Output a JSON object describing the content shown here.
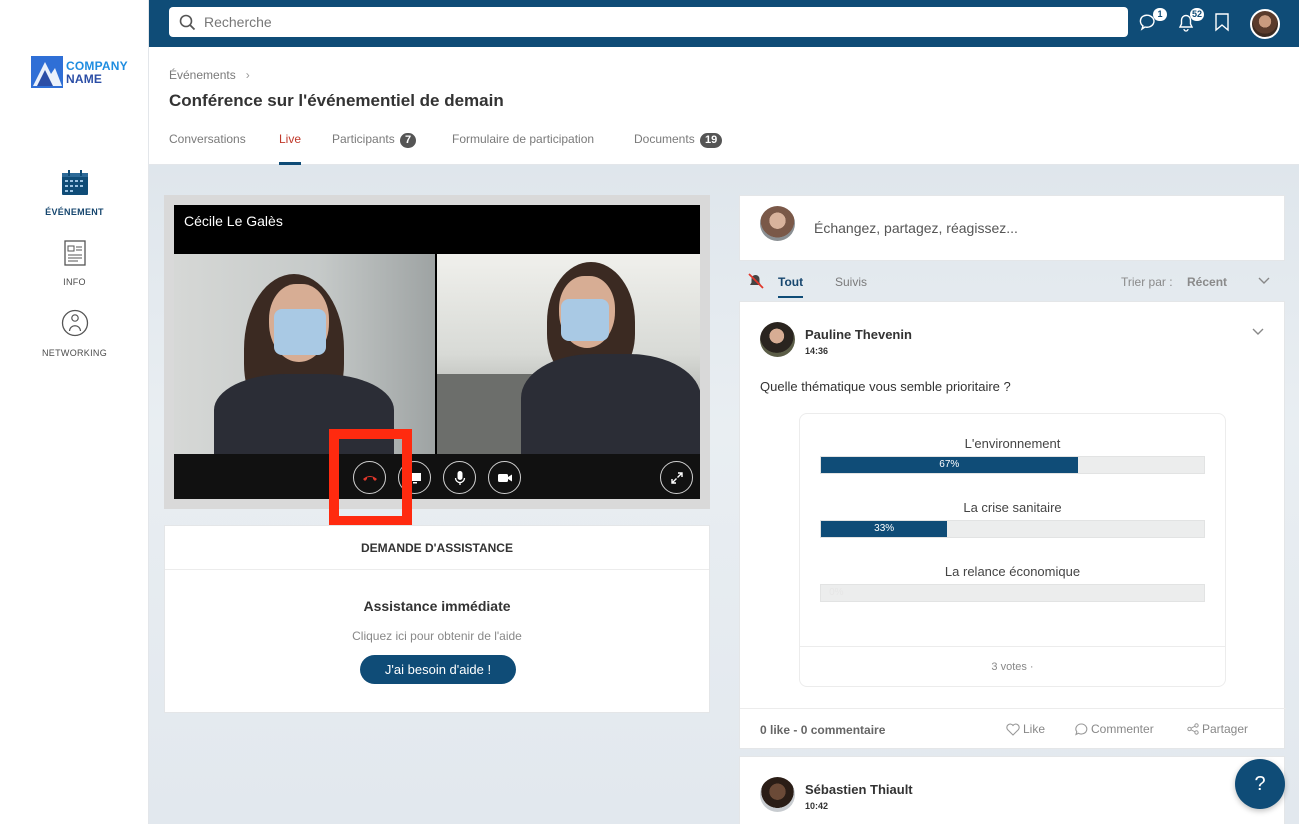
{
  "brand": {
    "line1": "COMPANY",
    "line2": "NAME"
  },
  "sidebar": {
    "items": [
      {
        "label": "ÉVÉNEMENT",
        "icon": "calendar-icon",
        "active": true
      },
      {
        "label": "INFO",
        "icon": "document-icon",
        "active": false
      },
      {
        "label": "NETWORKING",
        "icon": "person-icon",
        "active": false
      }
    ]
  },
  "topbar": {
    "search_placeholder": "Recherche",
    "chat_badge": "1",
    "notif_badge": "52"
  },
  "header": {
    "breadcrumb": "Événements",
    "title": "Conférence sur l'événementiel de demain",
    "tabs": [
      {
        "label": "Conversations"
      },
      {
        "label": "Live",
        "active": true
      },
      {
        "label": "Participants",
        "count": "7"
      },
      {
        "label": "Formulaire de participation"
      },
      {
        "label": "Documents",
        "count": "19"
      }
    ]
  },
  "video": {
    "speaker_name": "Cécile Le Galès"
  },
  "assistance": {
    "header": "DEMANDE D'ASSISTANCE",
    "title": "Assistance immédiate",
    "subtitle": "Cliquez ici pour obtenir de l'aide",
    "button": "J'ai besoin d'aide !"
  },
  "composer": {
    "placeholder": "Échangez, partagez, réagissez..."
  },
  "filters": {
    "all": "Tout",
    "followed": "Suivis",
    "sort_label": "Trier par :",
    "sort_value": "Récent"
  },
  "post1": {
    "author": "Pauline Thevenin",
    "time": "14:36",
    "question": "Quelle thématique vous semble prioritaire ?",
    "poll": {
      "options": [
        {
          "label": "L'environnement",
          "percent": 67,
          "percent_label": "67%"
        },
        {
          "label": "La crise sanitaire",
          "percent": 33,
          "percent_label": "33%"
        },
        {
          "label": "La relance économique",
          "percent": 0,
          "percent_label": "0%"
        }
      ],
      "votes": "3 votes ·"
    },
    "stats": "0 like - 0 commentaire",
    "actions": {
      "like": "Like",
      "comment": "Commenter",
      "share": "Partager"
    }
  },
  "post2": {
    "author": "Sébastien Thiault",
    "time": "10:42"
  },
  "help_button": "?",
  "colors": {
    "primary": "#0f4c77",
    "live_tab": "#c0392b",
    "highlight": "#ff2a0f"
  }
}
